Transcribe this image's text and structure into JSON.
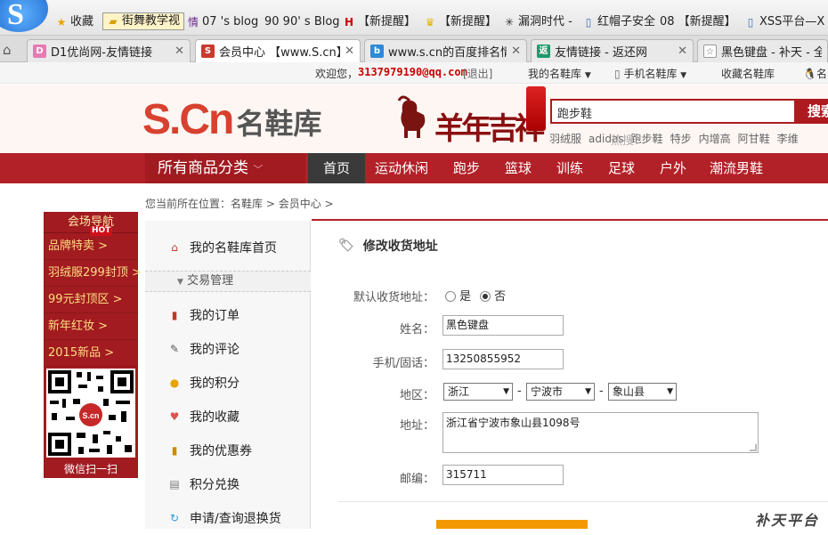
{
  "browser": {
    "logo_letter": "S",
    "bookmarks": [
      {
        "label": "收藏",
        "icon": "star-icon"
      },
      {
        "label": "街舞教学视",
        "icon": "folder-icon"
      },
      {
        "label": "07 's blog",
        "icon": "blog-icon"
      },
      {
        "label": "90 90' s Blog",
        "icon": "ninety-icon"
      },
      {
        "label": "【新提醒】",
        "icon": "hack-icon"
      },
      {
        "label": "【新提醒】",
        "icon": "crown-icon"
      },
      {
        "label": "漏洞时代 -",
        "icon": "spider-icon"
      },
      {
        "label": "红帽子安全",
        "icon": "page-icon"
      },
      {
        "label": "08 【新提醒】",
        "icon": "zero-eight-icon"
      },
      {
        "label": "XSS平台—X",
        "icon": "page-icon"
      }
    ],
    "tabs": [
      {
        "title": "D1优尚网-友情链接",
        "icon": "d1-favicon"
      },
      {
        "title": "会员中心 【www.S.cn】",
        "icon": "s-favicon"
      },
      {
        "title": "www.s.cn的百度排名情",
        "icon": "baidu-favicon"
      },
      {
        "title": "友情链接 - 返还网",
        "icon": "fan-favicon"
      },
      {
        "title": "黑色键盘 - 补天 - 全球",
        "icon": "butian-favicon"
      }
    ]
  },
  "topbar": {
    "welcome": "欢迎您，",
    "email": "3137979190@qq.com",
    "logout": "[退出]",
    "my_store": "我的名鞋库",
    "mobile_store": "手机名鞋库",
    "bookmark_store": "收藏名鞋库",
    "qq_label": "名"
  },
  "header": {
    "logo_s": "S.Cn",
    "logo_name": "名鞋库",
    "promo_text": "羊年吉祥",
    "search_value": "跑步鞋",
    "search_button": "搜索",
    "hot_label": "热搜：",
    "hot_terms": [
      "羽绒服",
      "adidas",
      "跑步鞋",
      "特步",
      "内增高",
      "阿甘鞋",
      "李维"
    ]
  },
  "nav": {
    "category": "所有商品分类",
    "items": [
      "首页",
      "运动休闲",
      "跑步",
      "篮球",
      "训练",
      "足球",
      "户外",
      "潮流男鞋"
    ]
  },
  "breadcrumb": {
    "prefix": "您当前所在位置：",
    "items": [
      "名鞋库",
      "会员中心"
    ]
  },
  "side_nav": {
    "title": "会场导航",
    "hot_badge": "HOT",
    "items": [
      "品牌特卖  >",
      "羽绒服299封顶 >",
      "99元封顶区  >",
      "新年红妆   >",
      "2015新品  >"
    ],
    "qr_caption": "微信扫一扫"
  },
  "left_menu": {
    "home": "我的名鞋库首页",
    "section": "交易管理",
    "items": [
      {
        "label": "我的订单",
        "icon": "order-icon"
      },
      {
        "label": "我的评论",
        "icon": "comment-icon"
      },
      {
        "label": "我的积分",
        "icon": "points-icon"
      },
      {
        "label": "我的收藏",
        "icon": "favorite-icon"
      },
      {
        "label": "我的优惠券",
        "icon": "coupon-icon"
      },
      {
        "label": "积分兑换",
        "icon": "exchange-icon"
      },
      {
        "label": "申请/查询退换货",
        "icon": "return-icon"
      }
    ]
  },
  "form": {
    "title": "修改收货地址",
    "default_label": "默认收货地址：",
    "opt_yes": "是",
    "opt_no": "否",
    "default_selected": "否",
    "name_label": "姓名：",
    "name_value": "黑色键盘",
    "phone_label": "手机/固话：",
    "phone_value": "13250855952",
    "region_label": "地区：",
    "province": "浙江",
    "city": "宁波市",
    "district": "象山县",
    "sep": "-",
    "address_label": "地址：",
    "address_value": "浙江省宁波市象山县1098号",
    "zip_label": "邮编：",
    "zip_value": "315711"
  },
  "watermark": "补天平台"
}
